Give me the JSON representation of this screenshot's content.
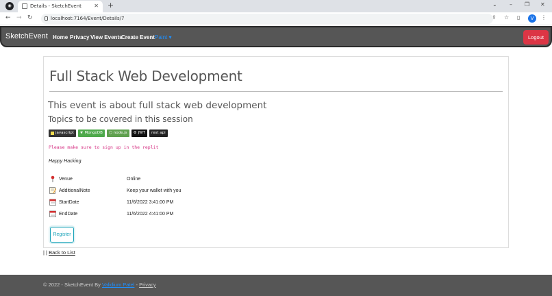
{
  "browser": {
    "tab_title": "Details - SketchEvent",
    "url": "localhost:7164/Event/Details/7",
    "profile_initial": "V"
  },
  "navbar": {
    "brand": "SketchEvent",
    "links": [
      "Home",
      "Privacy",
      "View Events",
      "Create Event",
      "Paint"
    ],
    "logout": "Logout"
  },
  "event": {
    "title": "Full Stack Web Development",
    "subtitle": "This event is about full stack web development",
    "topics_heading": "Topics to be covered in this session",
    "badges": [
      {
        "label": "javascript",
        "color": "#333333",
        "icon": "js-icon"
      },
      {
        "label": "MongoDB",
        "color": "#4ea94b",
        "icon": "leaf-icon"
      },
      {
        "label": "node.js",
        "color": "#5fa04e",
        "icon": "node-icon"
      },
      {
        "label": "JWT",
        "color": "#111111",
        "icon": "gear-icon"
      },
      {
        "label": "rest api",
        "color": "#222222",
        "icon": ""
      }
    ],
    "note_code": "Please make sure to sign up in the replit",
    "tagline": "Happy Hacking",
    "details": [
      {
        "icon": "pin-icon",
        "label": "Venue",
        "value": "Online"
      },
      {
        "icon": "memo-icon",
        "label": "AdditionalNote",
        "value": "Keep your wallet with you"
      },
      {
        "icon": "calendar-icon",
        "label": "StartDate",
        "value": "11/6/2022 3:41:00 PM"
      },
      {
        "icon": "calendar-icon",
        "label": "EndDate",
        "value": "11/6/2022 4:41:00 PM"
      }
    ],
    "register": "Register",
    "back_prefix": "| |",
    "back_link": "Back to List"
  },
  "footer": {
    "prefix": "© 2022 - SketchEvent By",
    "author": "Validium Patel",
    "sep": "-",
    "privacy": "Privacy"
  }
}
